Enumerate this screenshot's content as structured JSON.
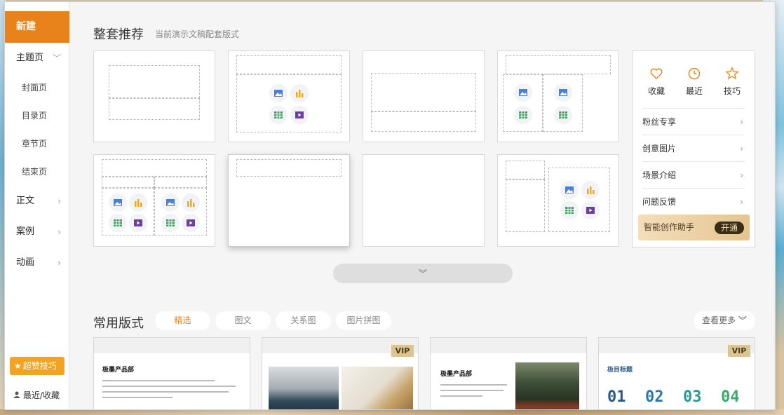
{
  "sidebar": {
    "new": "新建",
    "theme_pages": "主题页",
    "sub_items": [
      "封面页",
      "目录页",
      "章节页",
      "结束页"
    ],
    "body": "正文",
    "cases": "案例",
    "animation": "动画",
    "tips_button": "超赞技巧",
    "recent_fav": "最近/收藏"
  },
  "section1": {
    "title": "整套推荐",
    "subtitle": "当前演示文稿配套版式"
  },
  "side_panel": {
    "top": [
      "收藏",
      "最近",
      "技巧"
    ],
    "rows": [
      "粉丝专享",
      "创意图片",
      "场景介绍",
      "问题反馈"
    ],
    "ai_label": "智能创作助手",
    "ai_button": "开通"
  },
  "section2": {
    "title": "常用版式",
    "tabs": [
      "精选",
      "图文",
      "关系图",
      "图片拼图"
    ],
    "active_tab": "精选",
    "more": "查看更多",
    "thumbs": [
      {
        "title": "极墨产品部",
        "vip": ""
      },
      {
        "title": "",
        "vip": "VIP"
      },
      {
        "title": "极墨产品部",
        "vip": ""
      },
      {
        "title": "极目标题",
        "vip": "VIP",
        "numbers": [
          "01",
          "02",
          "03",
          "04"
        ]
      }
    ]
  },
  "colors": {
    "accent": "#e8821b",
    "tips": "#f2a321",
    "vip": "#ddc58f",
    "image_icon": "#4a7fd6",
    "chart_icon": "#f0a81f",
    "table_icon": "#3aa55a",
    "video_icon": "#6b3fa0"
  }
}
